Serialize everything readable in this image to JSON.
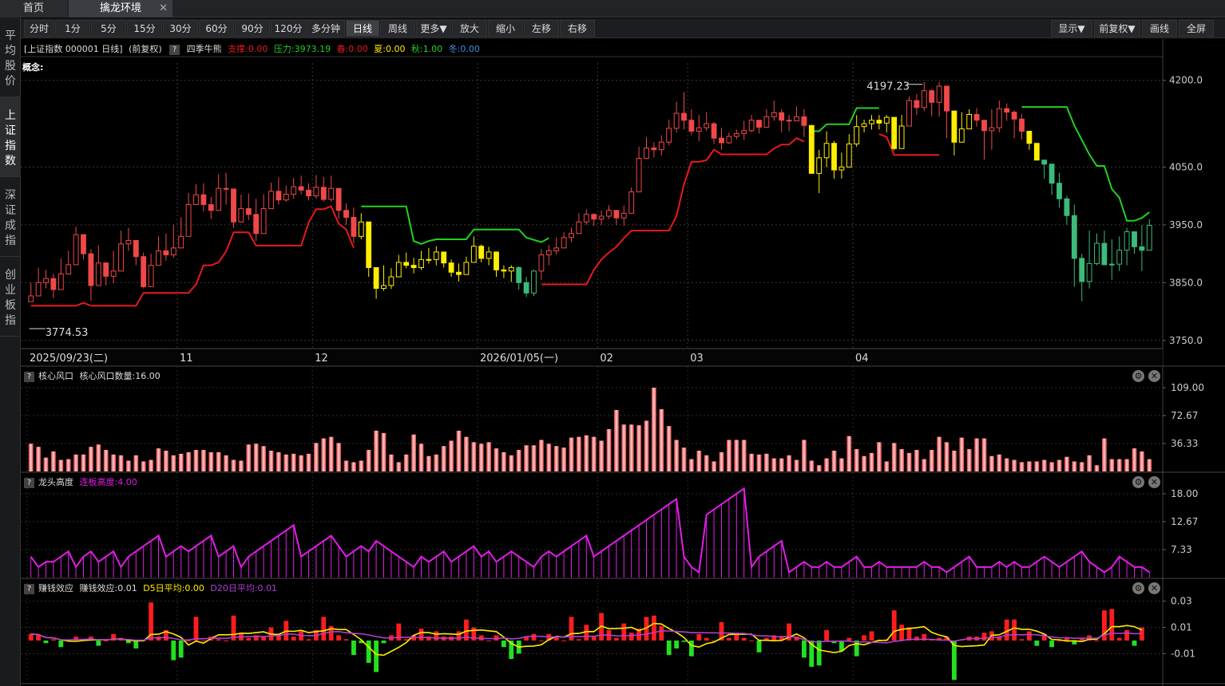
{
  "tabs": [
    {
      "label": "首页"
    },
    {
      "label": "擒龙环境"
    }
  ],
  "tab_close": "✕",
  "sidebar": [
    "平均股价",
    "上证指数",
    "深证成指",
    "创业板指"
  ],
  "toolbar": {
    "periods": [
      "分时",
      "1分",
      "5分",
      "15分",
      "30分",
      "60分",
      "90分",
      "120分",
      "多分钟",
      "日线",
      "周线",
      "更多▼",
      "放大",
      "缩小",
      "左移",
      "右移"
    ],
    "right": [
      "显示▼",
      "前复权▼",
      "画线",
      "全屏"
    ],
    "active": "日线"
  },
  "main_header": {
    "title": "[上证指数 000001 日线]",
    "adjust": "(前复权)",
    "indicator": "四季牛熊",
    "support": "支撑:0.00",
    "pressure": "压力:3973.19",
    "spring": "春:0.00",
    "summer": "夏:0.00",
    "autumn": "秋:1.00",
    "winter": "冬:0.00",
    "concept": "概念:"
  },
  "date_axis": [
    "2025/09/23(二)",
    "11",
    "12",
    "2026/01/05(一)",
    "02",
    "03",
    "04"
  ],
  "colors": {
    "up": "#f04848",
    "down": "#3dbb7a",
    "yellow": "#ffee00",
    "red_line": "#e8191d",
    "green_line": "#22d11f",
    "magenta": "#e31de8",
    "pressure": "#22d11f",
    "spring": "#e8191d",
    "summer": "#ffee00",
    "autumn": "#22d11f",
    "winter": "#3d8fe8"
  },
  "chart_data": [
    {
      "type": "candlestick",
      "title": "上证指数 000001 日线",
      "yticks": [
        4200.0,
        4050.0,
        3950.0,
        3850.0,
        3750.0
      ],
      "ylim": [
        3740,
        4230
      ],
      "high_label": "4197.23",
      "low_label": "3774.53",
      "closes": [
        3827,
        3850,
        3857,
        3838,
        3865,
        3881,
        3933,
        3900,
        3845,
        3884,
        3861,
        3870,
        3917,
        3923,
        3895,
        3843,
        3880,
        3905,
        3898,
        3910,
        3930,
        3985,
        4002,
        3985,
        3975,
        4013,
        4012,
        3955,
        3978,
        3968,
        3935,
        3978,
        4008,
        3993,
        4003,
        4016,
        4010,
        4000,
        4015,
        3994,
        4013,
        3975,
        3963,
        3930,
        3955,
        3876,
        3840,
        3845,
        3860,
        3885,
        3880,
        3876,
        3890,
        3890,
        3903,
        3884,
        3868,
        3864,
        3885,
        3913,
        3892,
        3903,
        3872,
        3870,
        3876,
        3850,
        3832,
        3870,
        3898,
        3905,
        3910,
        3928,
        3935,
        3955,
        3968,
        3960,
        3965,
        3975,
        3962,
        3970,
        4007,
        4065,
        4083,
        4080,
        4093,
        4117,
        4143,
        4131,
        4112,
        4118,
        4125,
        4100,
        4092,
        4103,
        4108,
        4113,
        4131,
        4119,
        4137,
        4144,
        4131,
        4130,
        4137,
        4122,
        4039,
        4066,
        4091,
        4045,
        4050,
        4090,
        4120,
        4125,
        4131,
        4126,
        4136,
        4082,
        4121,
        4165,
        4153,
        4182,
        4162,
        4190,
        4147,
        4093,
        4116,
        4141,
        4131,
        4113,
        4118,
        4151,
        4145,
        4133,
        4112,
        4091,
        4062,
        4055,
        4022,
        3995,
        3966,
        3892,
        3852,
        3883,
        3918,
        3881,
        3882,
        3906,
        3938,
        3912,
        3906,
        3949
      ],
      "highs": [
        3850,
        3876,
        3872,
        3865,
        3892,
        3905,
        3947,
        3920,
        3908,
        3915,
        3885,
        3905,
        3940,
        3945,
        3922,
        3902,
        3900,
        3930,
        3935,
        3950,
        3963,
        4005,
        4020,
        4022,
        3998,
        4038,
        4040,
        4005,
        4002,
        4004,
        3995,
        4003,
        4023,
        4032,
        4018,
        4031,
        4035,
        4022,
        4036,
        4033,
        4035,
        4008,
        3987,
        3980,
        3970,
        3910,
        3865,
        3880,
        3875,
        3898,
        3902,
        3893,
        3905,
        3910,
        3913,
        3903,
        3890,
        3883,
        3895,
        3930,
        3916,
        3912,
        3902,
        3880,
        3880,
        3878,
        3860,
        3872,
        3908,
        3915,
        3928,
        3937,
        3945,
        3970,
        3977,
        3970,
        3975,
        3984,
        3975,
        3983,
        4015,
        4085,
        4102,
        4093,
        4105,
        4132,
        4163,
        4180,
        4150,
        4140,
        4145,
        4128,
        4118,
        4110,
        4115,
        4130,
        4140,
        4130,
        4150,
        4165,
        4150,
        4140,
        4155,
        4150,
        4100,
        4080,
        4112,
        4095,
        4075,
        4107,
        4140,
        4132,
        4140,
        4140,
        4140,
        4125,
        4140,
        4172,
        4176,
        4197,
        4185,
        4197,
        4156,
        4130,
        4145,
        4150,
        4152,
        4128,
        4150,
        4165,
        4160,
        4148,
        4142,
        4110,
        4085,
        4060,
        4030,
        4040,
        4000,
        3985,
        3900,
        3940,
        3935,
        3940,
        3925,
        3930,
        3945,
        3935,
        3950,
        3960
      ],
      "lows": [
        3818,
        3830,
        3840,
        3823,
        3850,
        3865,
        3898,
        3890,
        3818,
        3877,
        3845,
        3849,
        3905,
        3905,
        3880,
        3840,
        3855,
        3893,
        3888,
        3893,
        3912,
        3970,
        3992,
        3973,
        3960,
        3992,
        3985,
        3945,
        3954,
        3958,
        3922,
        3962,
        3989,
        3985,
        3990,
        3995,
        4003,
        3992,
        3995,
        3990,
        3990,
        3960,
        3950,
        3918,
        3925,
        3860,
        3822,
        3836,
        3839,
        3864,
        3875,
        3866,
        3872,
        3883,
        3880,
        3876,
        3860,
        3852,
        3870,
        3885,
        3885,
        3880,
        3860,
        3858,
        3851,
        3838,
        3825,
        3827,
        3855,
        3880,
        3898,
        3910,
        3920,
        3935,
        3950,
        3948,
        3950,
        3960,
        3950,
        3948,
        3973,
        4028,
        4073,
        4067,
        4070,
        4088,
        4110,
        4115,
        4105,
        4095,
        4112,
        4090,
        4080,
        4090,
        4098,
        4097,
        4110,
        4108,
        4120,
        4130,
        4110,
        4112,
        4130,
        4102,
        4040,
        4005,
        4050,
        4030,
        4030,
        4060,
        4085,
        4110,
        4115,
        4115,
        4110,
        4079,
        4110,
        4128,
        4140,
        4147,
        4138,
        4137,
        4100,
        4070,
        4098,
        4125,
        4120,
        4063,
        4080,
        4110,
        4130,
        4100,
        4098,
        4080,
        4062,
        4030,
        4002,
        3980,
        3950,
        3843,
        3818,
        3840,
        3880,
        3880,
        3855,
        3870,
        3880,
        3900,
        3870,
        3930
      ],
      "colors_key": [
        "r",
        "r",
        "r",
        "r",
        "r",
        "r",
        "r",
        "r",
        "r",
        "r",
        "r",
        "r",
        "r",
        "r",
        "r",
        "r",
        "r",
        "r",
        "r",
        "r",
        "r",
        "r",
        "r",
        "r",
        "r",
        "r",
        "r",
        "r",
        "r",
        "r",
        "r",
        "r",
        "r",
        "r",
        "r",
        "r",
        "r",
        "r",
        "r",
        "r",
        "r",
        "r",
        "r",
        "r",
        "y",
        "y",
        "y",
        "y",
        "y",
        "y",
        "y",
        "y",
        "y",
        "y",
        "y",
        "y",
        "y",
        "y",
        "y",
        "y",
        "y",
        "y",
        "y",
        "y",
        "y",
        "g",
        "g",
        "g",
        "r",
        "r",
        "r",
        "r",
        "r",
        "r",
        "r",
        "r",
        "r",
        "r",
        "r",
        "r",
        "r",
        "r",
        "r",
        "r",
        "r",
        "r",
        "r",
        "r",
        "r",
        "r",
        "r",
        "r",
        "r",
        "r",
        "r",
        "r",
        "r",
        "r",
        "r",
        "r",
        "r",
        "r",
        "r",
        "r",
        "y",
        "y",
        "y",
        "y",
        "y",
        "y",
        "y",
        "y",
        "y",
        "y",
        "y",
        "y",
        "y",
        "r",
        "r",
        "r",
        "r",
        "r",
        "r",
        "y",
        "y",
        "y",
        "r",
        "r",
        "r",
        "r",
        "r",
        "r",
        "r",
        "y",
        "y",
        "g",
        "g",
        "g",
        "g",
        "g",
        "g",
        "g",
        "g",
        "g",
        "g",
        "g",
        "g",
        "g",
        "g",
        "g"
      ]
    },
    {
      "type": "bar",
      "title": "核心风口",
      "label": "核心风口数量:16.00",
      "yticks": [
        109.0,
        72.67,
        36.33
      ],
      "values": [
        36,
        32,
        18,
        26,
        15,
        16,
        22,
        22,
        32,
        35,
        28,
        22,
        21,
        14,
        21,
        13,
        15,
        30,
        27,
        21,
        23,
        25,
        28,
        28,
        25,
        25,
        21,
        15,
        14,
        35,
        36,
        33,
        27,
        25,
        22,
        23,
        21,
        23,
        37,
        43,
        45,
        37,
        14,
        12,
        14,
        28,
        53,
        50,
        22,
        12,
        22,
        48,
        36,
        20,
        22,
        33,
        40,
        53,
        45,
        38,
        36,
        38,
        30,
        25,
        21,
        28,
        34,
        34,
        41,
        36,
        33,
        31,
        44,
        45,
        47,
        45,
        40,
        55,
        80,
        61,
        61,
        60,
        66,
        109,
        81,
        59,
        41,
        31,
        16,
        27,
        21,
        13,
        25,
        41,
        41,
        41,
        23,
        22,
        23,
        17,
        17,
        21,
        15,
        41,
        14,
        8,
        17,
        27,
        17,
        46,
        29,
        20,
        24,
        38,
        13,
        37,
        29,
        24,
        28,
        16,
        28,
        45,
        38,
        27,
        44,
        29,
        43,
        43,
        20,
        22,
        17,
        15,
        12,
        13,
        13,
        15,
        12,
        15,
        19,
        13,
        12,
        21,
        8,
        43,
        16,
        16,
        16,
        30,
        26,
        16
      ]
    },
    {
      "type": "line",
      "title": "龙头高度",
      "label": "连板高度:4.00",
      "yticks": [
        18.0,
        12.67,
        7.33
      ],
      "values": [
        6,
        4,
        5,
        5,
        6,
        7,
        4,
        6,
        7,
        5,
        6,
        7,
        4,
        6,
        7,
        8,
        9,
        10,
        6,
        7,
        8,
        7,
        8,
        9,
        10,
        6,
        7,
        8,
        4,
        6,
        7,
        8,
        9,
        10,
        11,
        12,
        6,
        7,
        8,
        9,
        10,
        8,
        6,
        7,
        8,
        7,
        9,
        8,
        7,
        6,
        5,
        4,
        6,
        5,
        6,
        7,
        5,
        6,
        7,
        8,
        6,
        7,
        5,
        6,
        7,
        6,
        5,
        4,
        6,
        7,
        6,
        7,
        8,
        9,
        10,
        6,
        7,
        8,
        9,
        10,
        11,
        12,
        13,
        14,
        15,
        16,
        17,
        6,
        4,
        3,
        14,
        15,
        16,
        17,
        18,
        19,
        4,
        6,
        7,
        8,
        9,
        3,
        4,
        5,
        4,
        4,
        5,
        4,
        4,
        5,
        6,
        4,
        4,
        5,
        4,
        4,
        4,
        4,
        4,
        5,
        4,
        4,
        3,
        4,
        5,
        6,
        4,
        4,
        4,
        5,
        4,
        5,
        4,
        4,
        5,
        6,
        5,
        4,
        5,
        6,
        7,
        5,
        4,
        3,
        4,
        6,
        5,
        4,
        4,
        3
      ]
    },
    {
      "type": "bar",
      "title": "赚钱效应",
      "label": "赚钱效应:0.01",
      "d5": "D5日平均:0.00",
      "d20": "D20日平均:0.01",
      "yticks": [
        0.03,
        0.01,
        -0.01
      ],
      "values": [
        0.005,
        0.004,
        -0.002,
        0.001,
        -0.005,
        0.0,
        0.003,
        0.001,
        0.003,
        -0.004,
        0.0,
        0.005,
        0.002,
        -0.002,
        -0.006,
        0.0,
        0.029,
        0.003,
        0.008,
        -0.015,
        -0.013,
        0.0,
        0.018,
        0.0,
        0.003,
        0.001,
        0.0,
        0.019,
        0.005,
        0.002,
        0.004,
        0.003,
        0.01,
        0.004,
        0.015,
        0.003,
        0.007,
        0.001,
        0.008,
        0.018,
        0.011,
        0.004,
        0.001,
        -0.011,
        -0.002,
        -0.017,
        -0.024,
        -0.002,
        0.004,
        0.013,
        0.001,
        0.004,
        0.009,
        0.003,
        0.007,
        0.003,
        0.003,
        0.007,
        0.016,
        0.01,
        0.004,
        0.0,
        0.004,
        -0.005,
        -0.014,
        -0.01,
        0.003,
        0.005,
        0.0,
        0.005,
        0.003,
        0.0,
        0.018,
        0.001,
        0.012,
        0.003,
        0.021,
        0.008,
        0.002,
        0.013,
        0.006,
        0.009,
        0.018,
        0.019,
        0.011,
        -0.011,
        -0.006,
        -0.001,
        -0.012,
        0.005,
        0.002,
        0.0,
        0.014,
        0.002,
        0.006,
        0.002,
        0.0,
        -0.009,
        0.002,
        0.004,
        0.003,
        0.013,
        0.003,
        -0.013,
        -0.02,
        -0.019,
        0.008,
        -0.002,
        -0.008,
        0.002,
        -0.012,
        0.004,
        0.007,
        0.0,
        0.001,
        0.023,
        0.012,
        0.01,
        0.003,
        0.005,
        0.001,
        0.002,
        0.003,
        -0.03,
        0.001,
        0.003,
        0.003,
        0.006,
        0.007,
        0.003,
        0.016,
        0.016,
        0.001,
        0.007,
        -0.004,
        0.005,
        -0.005,
        0.0,
        0.002,
        -0.003,
        0.002,
        0.004,
        0.0,
        0.023,
        0.024,
        0.002,
        0.008,
        -0.004,
        0.01
      ]
    }
  ]
}
